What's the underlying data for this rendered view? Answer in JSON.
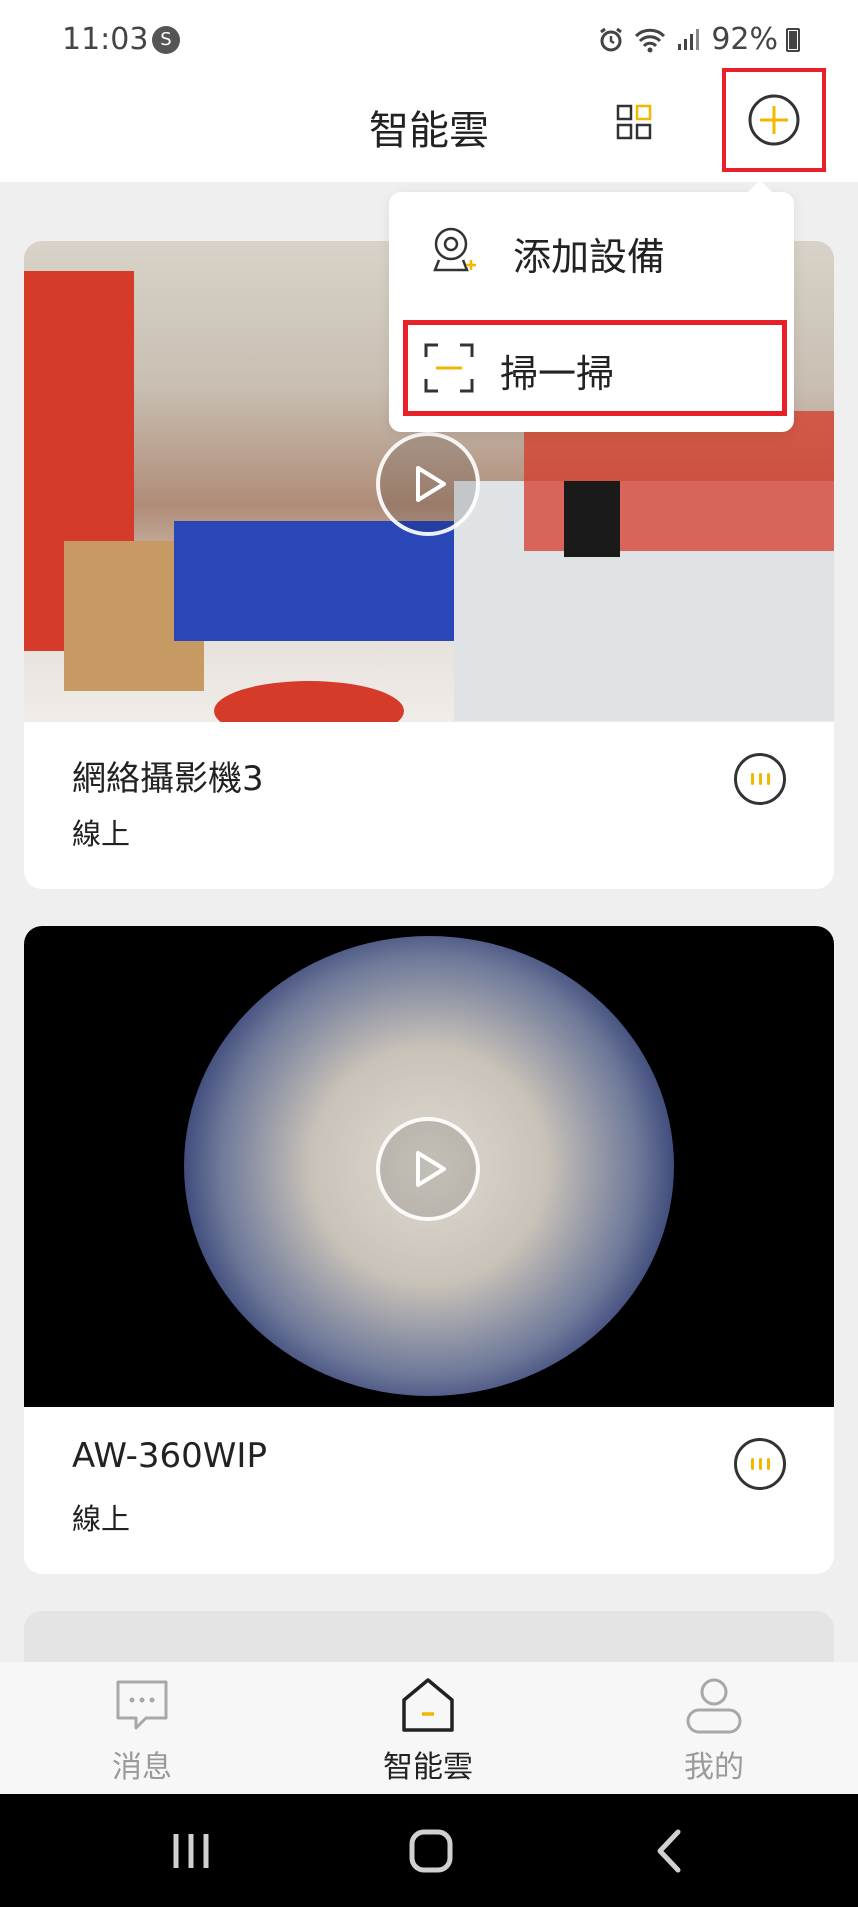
{
  "status_bar": {
    "time": "11:03",
    "battery": "92%"
  },
  "header": {
    "title": "智能雲"
  },
  "dropdown": {
    "items": [
      {
        "label": "添加設備",
        "icon": "add-camera-icon"
      },
      {
        "label": "掃一掃",
        "icon": "scan-icon"
      }
    ]
  },
  "devices": [
    {
      "name": "網絡攝影機3",
      "status": "線上"
    },
    {
      "name": "AW-360WIP",
      "status": "線上"
    }
  ],
  "bottom_nav": {
    "items": [
      {
        "label": "消息",
        "icon": "message-icon"
      },
      {
        "label": "智能雲",
        "icon": "home-icon"
      },
      {
        "label": "我的",
        "icon": "profile-icon"
      }
    ],
    "active": "智能雲"
  },
  "colors": {
    "accent": "#f2b800",
    "highlight_box": "#e8202a",
    "background": "#efefef"
  }
}
